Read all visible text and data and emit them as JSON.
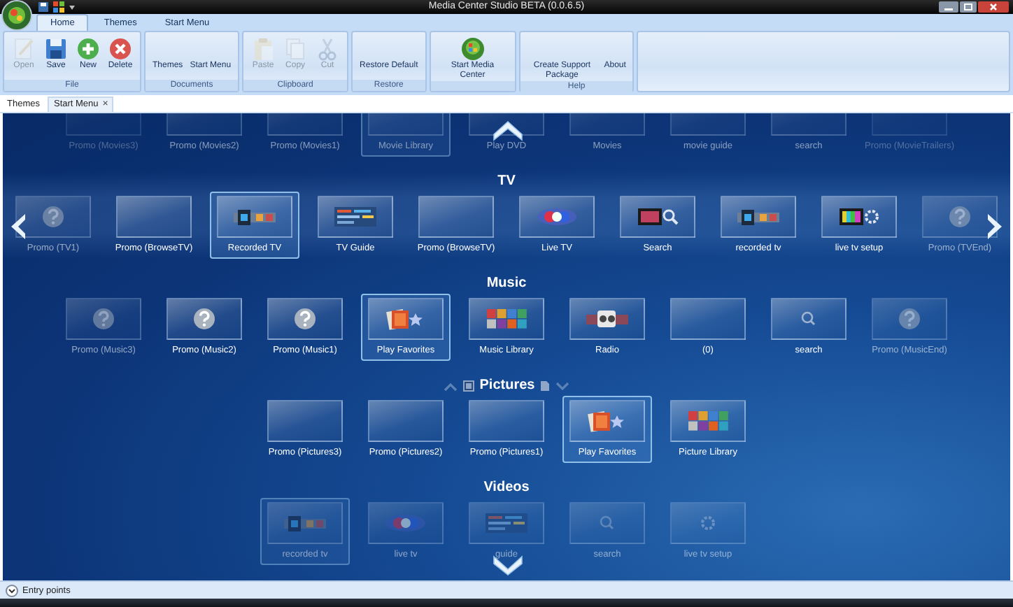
{
  "window": {
    "title": "Media Center Studio BETA (0.0.6.5)"
  },
  "ribbon": {
    "tabs": [
      {
        "label": "Home",
        "selected": true
      },
      {
        "label": "Themes",
        "selected": false
      },
      {
        "label": "Start Menu",
        "selected": false
      }
    ],
    "groups": [
      {
        "label": "File",
        "buttons": [
          {
            "label": "Open",
            "kind": "pencil",
            "disabled": true
          },
          {
            "label": "Save",
            "kind": "floppy",
            "disabled": false
          },
          {
            "label": "New",
            "kind": "plus",
            "disabled": false
          },
          {
            "label": "Delete",
            "kind": "delete",
            "disabled": false
          }
        ]
      },
      {
        "label": "Documents",
        "buttons": [
          {
            "label": "Themes",
            "kind": "text",
            "disabled": false
          },
          {
            "label": "Start Menu",
            "kind": "text",
            "disabled": false
          }
        ]
      },
      {
        "label": "Clipboard",
        "buttons": [
          {
            "label": "Paste",
            "kind": "paste",
            "disabled": true
          },
          {
            "label": "Copy",
            "kind": "copy",
            "disabled": true
          },
          {
            "label": "Cut",
            "kind": "cut",
            "disabled": true
          }
        ]
      },
      {
        "label": "Restore",
        "buttons": [
          {
            "label": "Restore Default",
            "kind": "text",
            "disabled": false
          }
        ]
      },
      {
        "buttons": [
          {
            "label": "Start Media Center",
            "kind": "orb",
            "disabled": false
          }
        ]
      },
      {
        "label": "Help",
        "buttons": [
          {
            "label": "Create Support Package",
            "kind": "text",
            "disabled": false
          },
          {
            "label": "About",
            "kind": "text",
            "disabled": false
          }
        ]
      }
    ]
  },
  "document_tabs": [
    {
      "label": "Themes",
      "selected": false
    },
    {
      "label": "Start Menu",
      "selected": true,
      "close": "×"
    }
  ],
  "sections": [
    {
      "dimmed": true,
      "items": [
        {
          "label": "Promo (Movies3)",
          "kind": "blank",
          "faded": true,
          "selected": false
        },
        {
          "label": "Promo (Movies2)",
          "kind": "blank",
          "faded": false,
          "selected": false
        },
        {
          "label": "Promo (Movies1)",
          "kind": "blank",
          "faded": false,
          "selected": false
        },
        {
          "label": "Movie Library",
          "kind": "blank",
          "faded": false,
          "selected": true
        },
        {
          "label": "Play DVD",
          "kind": "blank",
          "faded": false,
          "selected": false
        },
        {
          "label": "Movies",
          "kind": "blank",
          "faded": false,
          "selected": false
        },
        {
          "label": "movie guide",
          "kind": "blank",
          "faded": false,
          "selected": false
        },
        {
          "label": "search",
          "kind": "blank",
          "faded": false,
          "selected": false
        },
        {
          "label": "Promo (MovieTrailers)",
          "kind": "blank",
          "faded": true,
          "selected": false
        }
      ]
    },
    {
      "title": "TV",
      "dimmed": false,
      "items": [
        {
          "label": "Promo (TV1)",
          "kind": "question",
          "faded": true,
          "selected": false
        },
        {
          "label": "Promo (BrowseTV)",
          "kind": "blank",
          "faded": false,
          "selected": false
        },
        {
          "label": "Recorded TV",
          "kind": "strip",
          "faded": false,
          "selected": true
        },
        {
          "label": "TV Guide",
          "kind": "guide",
          "faded": false,
          "selected": false
        },
        {
          "label": "Promo (BrowseTV)",
          "kind": "blank",
          "faded": false,
          "selected": false
        },
        {
          "label": "Live TV",
          "kind": "glow",
          "faded": false,
          "selected": false
        },
        {
          "label": "Search",
          "kind": "screensearch",
          "faded": false,
          "selected": false
        },
        {
          "label": "recorded tv",
          "kind": "strip",
          "faded": false,
          "selected": false
        },
        {
          "label": "live tv setup",
          "kind": "screengear",
          "faded": false,
          "selected": false
        },
        {
          "label": "Promo (TVEnd)",
          "kind": "question",
          "faded": true,
          "selected": false
        }
      ]
    },
    {
      "title": "Music",
      "dimmed": false,
      "items": [
        {
          "label": "Promo (Music3)",
          "kind": "question",
          "faded": true,
          "selected": false
        },
        {
          "label": "Promo (Music2)",
          "kind": "question",
          "faded": false,
          "selected": false
        },
        {
          "label": "Promo (Music1)",
          "kind": "question",
          "faded": false,
          "selected": false
        },
        {
          "label": "Play Favorites",
          "kind": "favorites",
          "faded": false,
          "selected": true
        },
        {
          "label": "Music Library",
          "kind": "library",
          "faded": false,
          "selected": false
        },
        {
          "label": "Radio",
          "kind": "radio",
          "faded": false,
          "selected": false
        },
        {
          "label": "(0)",
          "kind": "blank",
          "faded": false,
          "selected": false
        },
        {
          "label": "search",
          "kind": "search",
          "faded": false,
          "selected": false
        },
        {
          "label": "Promo (MusicEnd)",
          "kind": "question",
          "faded": true,
          "selected": false
        }
      ]
    },
    {
      "title": "Pictures",
      "dimmed": false,
      "controls": true,
      "checked": true,
      "items": [
        {
          "label": "Promo (Pictures3)",
          "kind": "blank",
          "faded": false,
          "selected": false
        },
        {
          "label": "Promo (Pictures2)",
          "kind": "blank",
          "faded": false,
          "selected": false
        },
        {
          "label": "Promo (Pictures1)",
          "kind": "blank",
          "faded": false,
          "selected": false
        },
        {
          "label": "Play Favorites",
          "kind": "favorites",
          "faded": false,
          "selected": true
        },
        {
          "label": "Picture Library",
          "kind": "library",
          "faded": false,
          "selected": false
        }
      ]
    },
    {
      "title": "Videos",
      "dimmed": true,
      "items": [
        {
          "label": "recorded tv",
          "kind": "strip",
          "faded": false,
          "selected": true
        },
        {
          "label": "live tv",
          "kind": "glow",
          "faded": false,
          "selected": false
        },
        {
          "label": "guide",
          "kind": "guide",
          "faded": false,
          "selected": false
        },
        {
          "label": "search",
          "kind": "search",
          "faded": false,
          "selected": false
        },
        {
          "label": "live tv setup",
          "kind": "gear",
          "faded": false,
          "selected": false
        }
      ]
    }
  ],
  "status_bar": {
    "label": "Entry points"
  }
}
